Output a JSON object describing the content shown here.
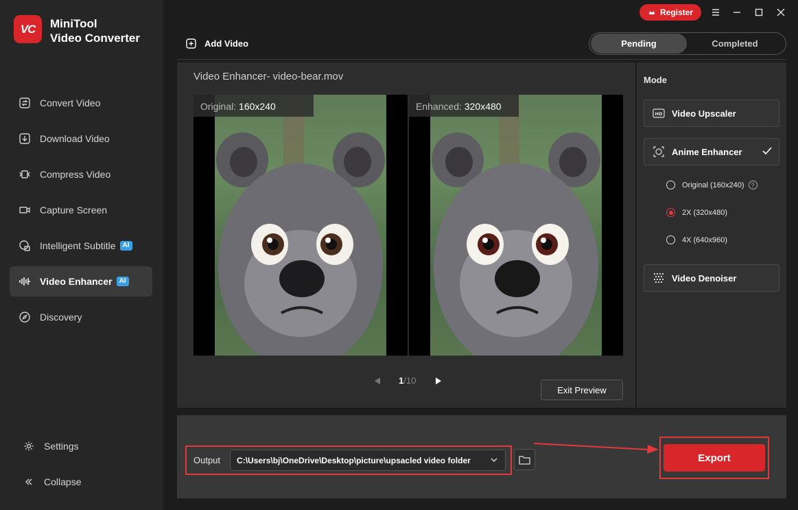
{
  "app": {
    "logo_text": "VC",
    "title_line1": "MiniTool",
    "title_line2": "Video Converter"
  },
  "titlebar": {
    "register_label": "Register"
  },
  "sidebar": {
    "items": [
      {
        "label": "Convert Video",
        "icon": "convert-icon"
      },
      {
        "label": "Download Video",
        "icon": "download-icon"
      },
      {
        "label": "Compress Video",
        "icon": "compress-icon"
      },
      {
        "label": "Capture Screen",
        "icon": "camera-icon"
      },
      {
        "label": "Intelligent Subtitle",
        "icon": "subtitle-icon",
        "badge": "AI"
      },
      {
        "label": "Video Enhancer",
        "icon": "waveform-icon",
        "badge": "AI",
        "active": true
      },
      {
        "label": "Discovery",
        "icon": "compass-icon"
      }
    ],
    "settings_label": "Settings",
    "collapse_label": "Collapse"
  },
  "toolbar": {
    "add_video_label": "Add Video",
    "tabs": [
      {
        "label": "Pending",
        "active": true
      },
      {
        "label": "Completed"
      }
    ]
  },
  "preview": {
    "title": "Video Enhancer- video-bear.mov",
    "original_prefix": "Original:",
    "original_res": "160x240",
    "enhanced_prefix": "Enhanced:",
    "enhanced_res": "320x480",
    "page_current": "1",
    "page_total": "/10",
    "exit_label": "Exit Preview"
  },
  "mode": {
    "title": "Mode",
    "upscaler_label": "Video Upscaler",
    "anime_label": "Anime Enhancer",
    "options": [
      {
        "label": "Original (160x240)",
        "selected": false
      },
      {
        "label": "2X (320x480)",
        "selected": true
      },
      {
        "label": "4X (640x960)",
        "selected": false
      }
    ],
    "denoiser_label": "Video Denoiser"
  },
  "output": {
    "label": "Output",
    "path": "C:\\Users\\bj\\OneDrive\\Desktop\\picture\\upsacled video folder",
    "export_label": "Export"
  },
  "colors": {
    "accent": "#d9262a",
    "ai_badge": "#3aa0e6",
    "sidebar_bg": "#262626",
    "panel_bg": "#2d2d2d"
  }
}
